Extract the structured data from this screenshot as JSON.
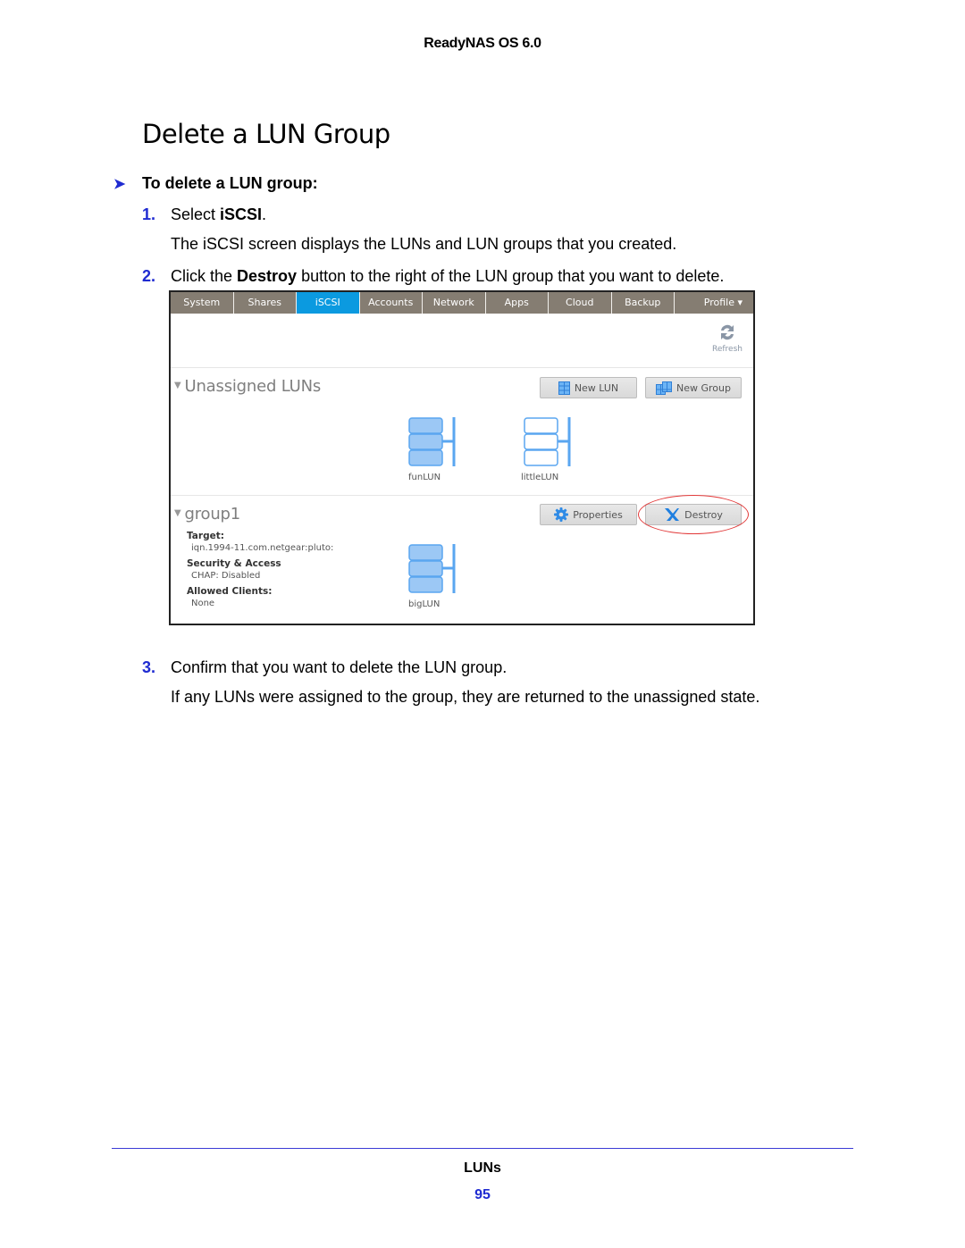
{
  "header": {
    "running_title": "ReadyNAS OS 6.0"
  },
  "section": {
    "title": "Delete a LUN Group"
  },
  "procedure": {
    "marker_icon": "arrow-right-icon",
    "heading": "To delete a LUN group:",
    "steps": [
      {
        "num": "1.",
        "pre": "Select ",
        "bold": "iSCSI",
        "post": ".",
        "para": "The iSCSI screen displays the LUNs and LUN groups that you created."
      },
      {
        "num": "2.",
        "pre": "Click the ",
        "bold": "Destroy",
        "post": " button to the right of the LUN group that you want to delete."
      },
      {
        "num": "3.",
        "text": "Confirm that you want to delete the LUN group.",
        "para": "If any LUNs were assigned to the group, they are returned to the unassigned state."
      }
    ]
  },
  "screenshot": {
    "nav_tabs": [
      {
        "label": "System"
      },
      {
        "label": "Shares"
      },
      {
        "label": "iSCSI",
        "active": true
      },
      {
        "label": "Accounts"
      },
      {
        "label": "Network"
      },
      {
        "label": "Apps"
      },
      {
        "label": "Cloud"
      },
      {
        "label": "Backup"
      },
      {
        "label": "Profile ▾"
      }
    ],
    "refresh_label": "Refresh",
    "unassigned": {
      "title": "Unassigned LUNs",
      "new_lun_label": "New LUN",
      "new_group_label": "New Group",
      "luns": [
        {
          "name": "funLUN",
          "filled": true
        },
        {
          "name": "littleLUN",
          "filled": false
        }
      ]
    },
    "group": {
      "title": "group1",
      "properties_label": "Properties",
      "destroy_label": "Destroy",
      "target_label": "Target:",
      "target_value": "iqn.1994-11.com.netgear:pluto:",
      "security_label": "Security & Access",
      "security_value": "CHAP: Disabled",
      "clients_label": "Allowed Clients:",
      "clients_value": "None",
      "luns": [
        {
          "name": "bigLUN",
          "filled": true
        }
      ]
    },
    "colors": {
      "nav_bg": "#857d72",
      "active_tab": "#0b9ae0",
      "lun_blue": "#5aa6f0",
      "highlight": "#e23a3a"
    }
  },
  "footer": {
    "chapter": "LUNs",
    "page": "95"
  }
}
